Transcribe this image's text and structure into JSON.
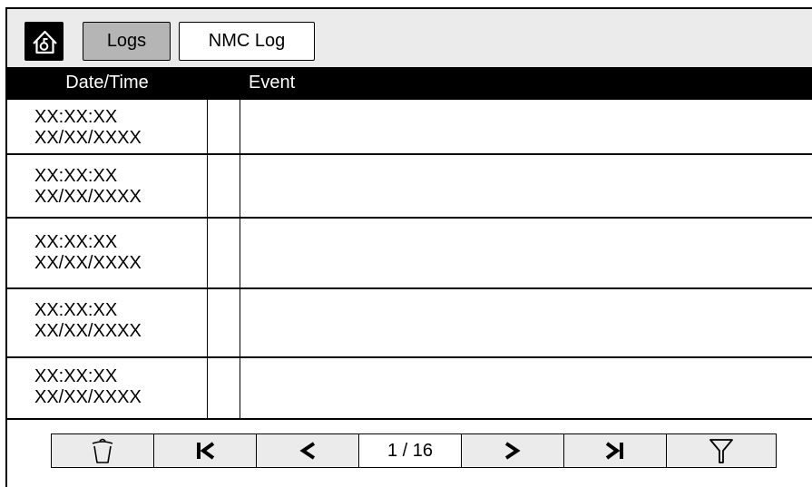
{
  "header": {
    "home_icon": "home-icon",
    "logs_tab": "Logs",
    "nmc_tab": "NMC Log"
  },
  "table": {
    "columns": [
      "Date/Time",
      "Event"
    ],
    "rows": [
      {
        "time": "XX:XX:XX",
        "date": "XX/XX/XXXX",
        "event": ""
      },
      {
        "time": "XX:XX:XX",
        "date": "XX/XX/XXXX",
        "event": ""
      },
      {
        "time": "XX:XX:XX",
        "date": "XX/XX/XXXX",
        "event": ""
      },
      {
        "time": "XX:XX:XX",
        "date": "XX/XX/XXXX",
        "event": ""
      },
      {
        "time": "XX:XX:XX",
        "date": "XX/XX/XXXX",
        "event": ""
      }
    ]
  },
  "pager": {
    "page_indicator": "1 / 16",
    "icons": [
      "trash-icon",
      "first-page-icon",
      "prev-page-icon",
      "next-page-icon",
      "last-page-icon",
      "filter-icon"
    ]
  }
}
